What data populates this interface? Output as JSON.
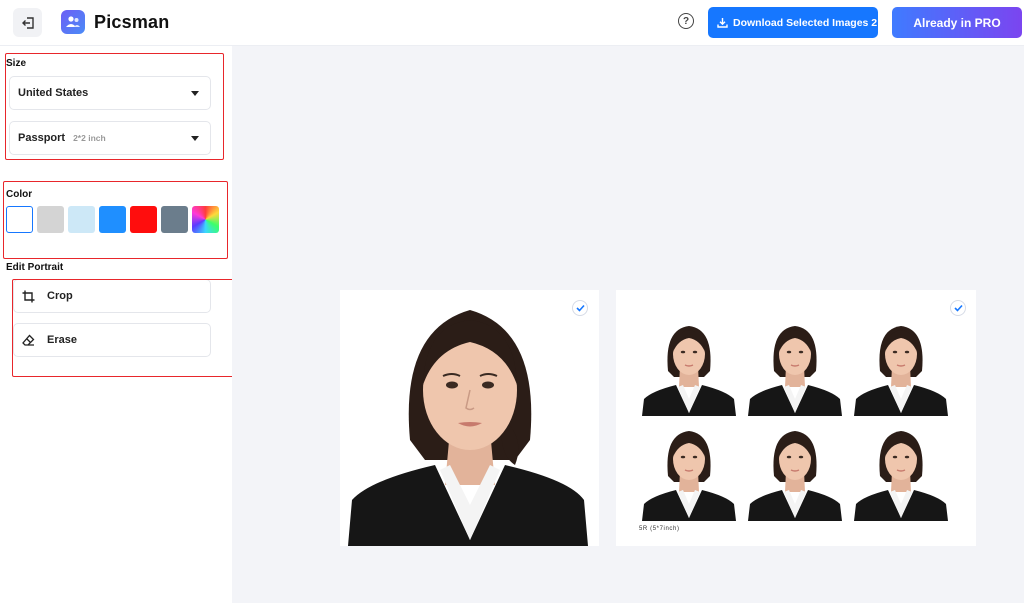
{
  "header": {
    "app_name": "Picsman",
    "download_label": "Download Selected Images 2",
    "pro_label": "Already in PRO",
    "icons": {
      "back": "exit-icon",
      "help": "question-icon",
      "download": "download-icon"
    }
  },
  "sidebar": {
    "size": {
      "title": "Size",
      "country": "United States",
      "doc_type": "Passport",
      "doc_size": "2*2 inch"
    },
    "color": {
      "title": "Color",
      "swatches": [
        "#ffffff",
        "#d4d4d4",
        "#cde8f7",
        "#1f8fff",
        "#ff0d0d",
        "#6b7d8c",
        "gradient"
      ],
      "selected_index": 0
    },
    "edit": {
      "title": "Edit Portrait",
      "crop_label": "Crop",
      "erase_label": "Erase"
    }
  },
  "main": {
    "single_photo": {
      "selected": true
    },
    "print_sheet": {
      "selected": true,
      "caption": "5R (5*7inch)",
      "photo_count": 6
    }
  },
  "colors": {
    "accent": "#1677ff",
    "highlight_box": "#e8262b"
  }
}
